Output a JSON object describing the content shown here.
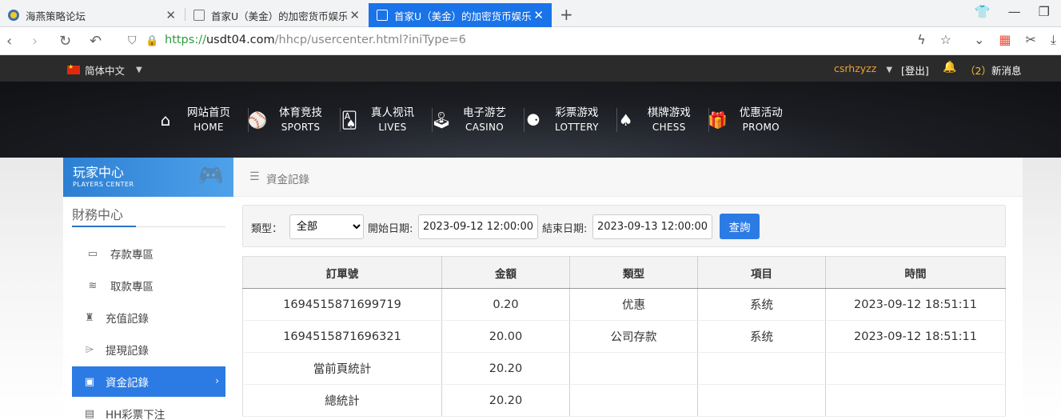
{
  "browser": {
    "tabs": [
      {
        "title": "海燕策略论坛"
      },
      {
        "title": "首家U（美金）的加密货币娱乐"
      },
      {
        "title": "首家U（美金）的加密货币娱乐"
      }
    ],
    "url_scheme": "https://",
    "url_host": "usdt04.com",
    "url_path": "/hhcp/usercenter.html?iniType=6"
  },
  "topbar": {
    "language": "简体中文",
    "username": "csrhzyzz",
    "logout": "[登出]",
    "msg_count": "（2）",
    "msg_label": "新消息"
  },
  "nav": [
    {
      "cn": "网站首页",
      "en": "HOME"
    },
    {
      "cn": "体育竞技",
      "en": "SPORTS"
    },
    {
      "cn": "真人视讯",
      "en": "LIVES"
    },
    {
      "cn": "电子游艺",
      "en": "CASINO"
    },
    {
      "cn": "彩票游戏",
      "en": "LOTTERY"
    },
    {
      "cn": "棋牌游戏",
      "en": "CHESS"
    },
    {
      "cn": "优惠活动",
      "en": "PROMO"
    }
  ],
  "sidebar": {
    "header_cn": "玩家中心",
    "header_en": "PLAYERS CENTER",
    "section": "財務中心",
    "items": [
      {
        "label": "存款專區"
      },
      {
        "label": "取款專區"
      },
      {
        "label": "充值記錄"
      },
      {
        "label": "提現記錄"
      },
      {
        "label": "資金記錄"
      },
      {
        "label": "HH彩票下注"
      }
    ]
  },
  "main": {
    "breadcrumb": "資金記錄",
    "filter": {
      "type_label": "類型：",
      "type_value": "全部",
      "start_label": "開始日期:",
      "start_value": "2023-09-12 12:00:00",
      "end_label": "結束日期:",
      "end_value": "2023-09-13 12:00:00",
      "query_button": "查詢"
    },
    "table": {
      "headers": [
        "訂單號",
        "金額",
        "類型",
        "項目",
        "時間"
      ],
      "rows": [
        [
          "1694515871699719",
          "0.20",
          "优惠",
          "系统",
          "2023-09-12 18:51:11"
        ],
        [
          "1694515871696321",
          "20.00",
          "公司存款",
          "系统",
          "2023-09-12 18:51:11"
        ],
        [
          "當前頁統計",
          "20.20",
          "",
          "",
          ""
        ],
        [
          "總統計",
          "20.20",
          "",
          "",
          ""
        ]
      ]
    }
  }
}
